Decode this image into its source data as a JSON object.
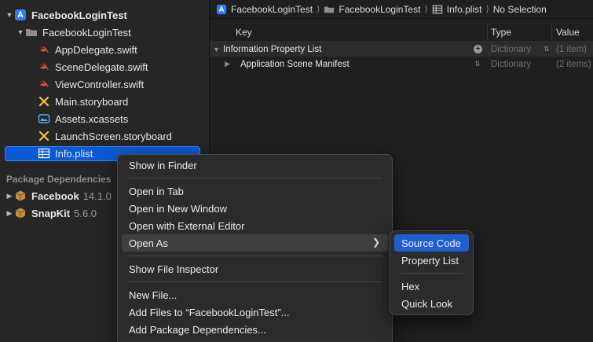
{
  "navigator": {
    "items": [
      {
        "label": "FacebookLoginTest",
        "icon": "xcode-project-icon"
      },
      {
        "label": "FacebookLoginTest",
        "icon": "folder-icon"
      },
      {
        "label": "AppDelegate.swift",
        "icon": "swift-file-icon"
      },
      {
        "label": "SceneDelegate.swift",
        "icon": "swift-file-icon"
      },
      {
        "label": "ViewController.swift",
        "icon": "swift-file-icon"
      },
      {
        "label": "Main.storyboard",
        "icon": "storyboard-icon"
      },
      {
        "label": "Assets.xcassets",
        "icon": "asset-catalog-icon"
      },
      {
        "label": "LaunchScreen.storyboard",
        "icon": "storyboard-icon"
      },
      {
        "label": "Info.plist",
        "icon": "plist-table-icon"
      }
    ],
    "package_header": "Package Dependencies",
    "packages": [
      {
        "name": "Facebook",
        "version": "14.1.0"
      },
      {
        "name": "SnapKit",
        "version": "5.6.0"
      }
    ],
    "colors": {
      "swift": "#f05138",
      "storyboard": "#f3c53f",
      "selection": "#0a5ad6"
    }
  },
  "jumpbar": {
    "crumbs": [
      "FacebookLoginTest",
      "FacebookLoginTest",
      "Info.plist",
      "No Selection"
    ]
  },
  "plist": {
    "columns": [
      "Key",
      "Type",
      "Value"
    ],
    "rows": [
      {
        "key": "Information Property List",
        "type": "Dictionary",
        "value": "(1 item)"
      },
      {
        "key": "Application Scene Manifest",
        "type": "Dictionary",
        "value": "(2 items)"
      }
    ]
  },
  "context_menu": {
    "items": [
      "Show in Finder",
      "Open in Tab",
      "Open in New Window",
      "Open with External Editor",
      "Open As",
      "Show File Inspector",
      "New File...",
      "Add Files to “FacebookLoginTest”...",
      "Add Package Dependencies..."
    ],
    "highlighted": "Open As"
  },
  "submenu": {
    "items": [
      "Source Code",
      "Property List",
      "Hex",
      "Quick Look"
    ],
    "active": "Source Code",
    "accent": "#1d5fd1"
  }
}
